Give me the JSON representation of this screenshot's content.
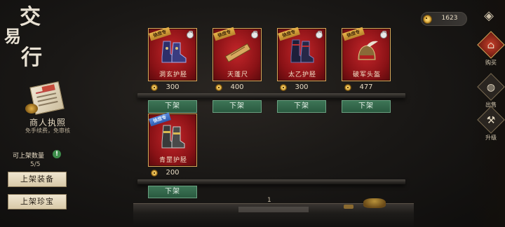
{
  "title": {
    "chars": [
      "交",
      "易",
      "行"
    ]
  },
  "license": {
    "stamp": "商人执照",
    "name": "商人执照",
    "desc": "免手续费，免审核"
  },
  "quota": {
    "label": "可上架数量",
    "info_icon": "!",
    "value": "5/5"
  },
  "left_buttons": {
    "list_equipment": "上架装备",
    "list_treasure": "上架珍宝"
  },
  "currency": {
    "icon": "coin-icon",
    "value": "1623"
  },
  "side_tabs": [
    {
      "label": "购买",
      "icon": "shop-icon",
      "active": true
    },
    {
      "label": "出售",
      "icon": "pouch-icon",
      "active": false
    },
    {
      "label": "升级",
      "icon": "hammer-icon",
      "active": false
    }
  ],
  "items": [
    {
      "badge": "徐庶专",
      "badge_color": "gold",
      "name": "洞玄护胫",
      "art": "boots-icon",
      "price": "300",
      "action": "下架"
    },
    {
      "badge": "徐庶专",
      "badge_color": "gold",
      "name": "天蓬尺",
      "art": "ruler-icon",
      "price": "400",
      "action": "下架"
    },
    {
      "badge": "徐庶专",
      "badge_color": "gold",
      "name": "太乙护胫",
      "art": "boots-icon",
      "price": "300",
      "action": "下架"
    },
    {
      "badge": "徐庶专",
      "badge_color": "gold",
      "name": "破军头盔",
      "art": "helmet-icon",
      "price": "477",
      "action": "下架"
    },
    {
      "badge": "徐庶专",
      "badge_color": "blue",
      "name": "青罡护胫",
      "art": "boots-icon",
      "price": "200",
      "action": "下架"
    }
  ],
  "page": "1"
}
